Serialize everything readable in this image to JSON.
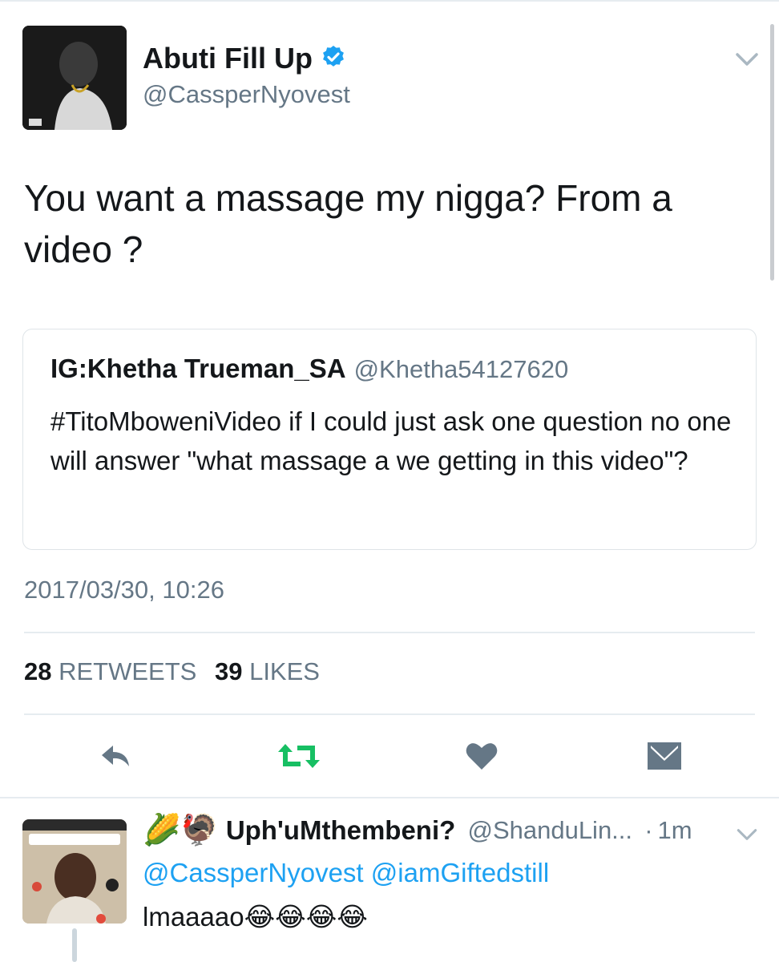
{
  "tweet": {
    "author_name": "Abuti Fill Up",
    "author_handle": "@CassperNyovest",
    "text": "You want a massage my nigga? From a video ?",
    "timestamp": "2017/03/30, 10:26",
    "retweet_count": "28",
    "retweet_label": "RETWEETS",
    "like_count": "39",
    "like_label": "LIKES",
    "verified_color": "#1da1f2"
  },
  "quoted_tweet": {
    "author_name": "IG:Khetha Trueman_SA",
    "author_handle": "@Khetha54127620",
    "text": "#TitoMboweniVideo if I could just ask one question no one will answer \"what massage a we getting in this video\"?"
  },
  "actions": {
    "reply_icon": "reply-icon",
    "retweet_icon": "retweet-icon",
    "retweet_color": "#17bf63",
    "like_icon": "heart-icon",
    "message_icon": "envelope-icon",
    "icon_color": "#657786"
  },
  "reply": {
    "emojis": "🌽🦃",
    "author_name": "Uph'uMthembeni?",
    "author_handle": "@ShanduLin...",
    "separator": "·",
    "time": "1m",
    "mention_1": "@CassperNyovest",
    "mention_2": "@iamGiftedstill",
    "text": "lmaaaao😂😂😂😂"
  }
}
